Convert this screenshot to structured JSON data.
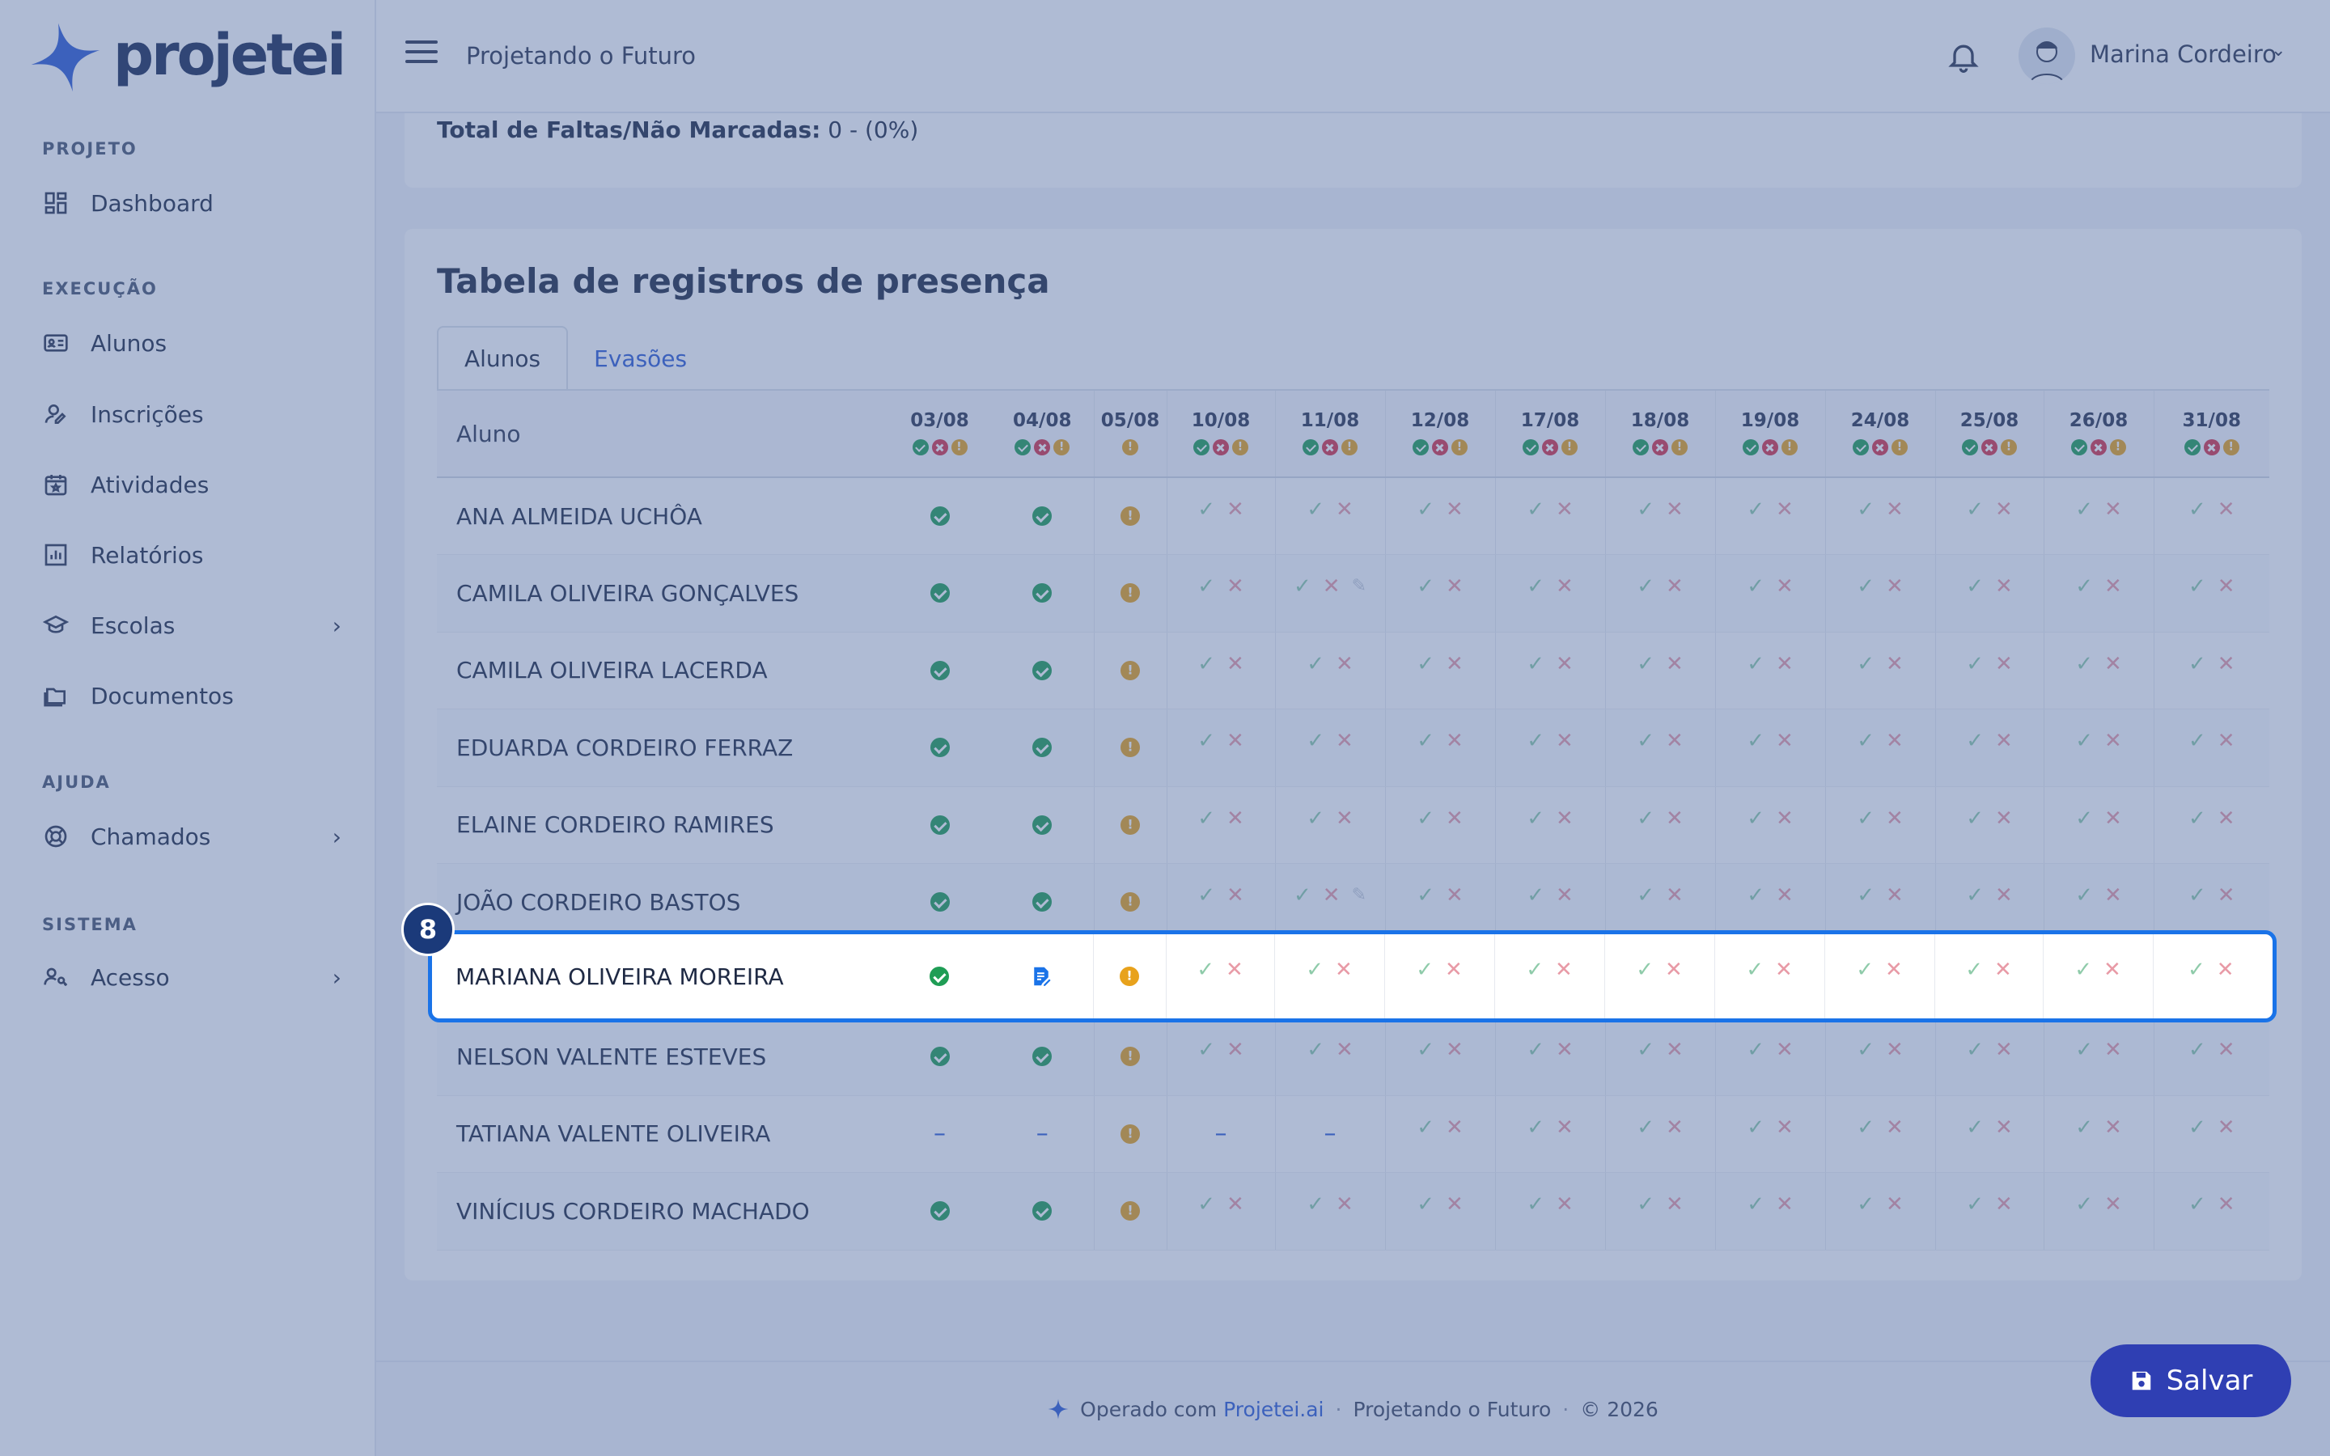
{
  "brand": {
    "logo_text": "projetei"
  },
  "sidebar": {
    "sections": [
      {
        "label": "PROJETO"
      },
      {
        "label": "EXECUÇÃO"
      },
      {
        "label": "AJUDA"
      },
      {
        "label": "SISTEMA"
      }
    ],
    "items": [
      {
        "label": "Dashboard",
        "icon": "dashboard-icon"
      },
      {
        "label": "Alunos",
        "icon": "id-card-icon"
      },
      {
        "label": "Inscrições",
        "icon": "user-edit-icon"
      },
      {
        "label": "Atividades",
        "icon": "calendar-icon"
      },
      {
        "label": "Relatórios",
        "icon": "bar-chart-icon"
      },
      {
        "label": "Escolas",
        "icon": "school-icon"
      },
      {
        "label": "Documentos",
        "icon": "folder-icon"
      },
      {
        "label": "Chamados",
        "icon": "lifebuoy-icon"
      },
      {
        "label": "Acesso",
        "icon": "user-key-icon"
      }
    ]
  },
  "topbar": {
    "title": "Projetando o Futuro",
    "user_name": "Marina Cordeiro"
  },
  "summary": {
    "label": "Total de Faltas/Não Marcadas:",
    "value": "0 - (0%)"
  },
  "attendance": {
    "title": "Tabela de registros de presença",
    "tabs": [
      "Alunos",
      "Evasões"
    ],
    "column_header": "Aluno",
    "dates": [
      "03/08",
      "04/08",
      "05/08",
      "10/08",
      "11/08",
      "12/08",
      "17/08",
      "18/08",
      "19/08",
      "24/08",
      "25/08",
      "26/08",
      "31/08"
    ],
    "rows": [
      {
        "name": "ANA ALMEIDA UCHÔA",
        "cells": [
          "ok",
          "ok",
          "wa",
          "f",
          "f",
          "f",
          "f",
          "f",
          "f",
          "f",
          "f",
          "f",
          "f"
        ]
      },
      {
        "name": "CAMILA OLIVEIRA GONÇALVES",
        "cells": [
          "ok",
          "ok",
          "wa",
          "f",
          "fd",
          "f",
          "f",
          "f",
          "f",
          "f",
          "f",
          "f",
          "f"
        ]
      },
      {
        "name": "CAMILA OLIVEIRA LACERDA",
        "cells": [
          "ok",
          "ok",
          "wa",
          "f",
          "f",
          "f",
          "f",
          "f",
          "f",
          "f",
          "f",
          "f",
          "f"
        ]
      },
      {
        "name": "EDUARDA CORDEIRO FERRAZ",
        "cells": [
          "ok",
          "ok",
          "wa",
          "f",
          "f",
          "f",
          "f",
          "f",
          "f",
          "f",
          "f",
          "f",
          "f"
        ]
      },
      {
        "name": "ELAINE CORDEIRO RAMIRES",
        "cells": [
          "ok",
          "ok",
          "wa",
          "f",
          "f",
          "f",
          "f",
          "f",
          "f",
          "f",
          "f",
          "f",
          "f"
        ]
      },
      {
        "name": "JOÃO CORDEIRO BASTOS",
        "cells": [
          "ok",
          "ok",
          "wa",
          "f",
          "fd",
          "f",
          "f",
          "f",
          "f",
          "f",
          "f",
          "f",
          "f"
        ]
      },
      {
        "name": "MARIANA OLIVEIRA MOREIRA",
        "cells": [
          "ok",
          "note",
          "wa",
          "f",
          "f",
          "f",
          "f",
          "f",
          "f",
          "f",
          "f",
          "f",
          "f"
        ]
      },
      {
        "name": "NELSON VALENTE ESTEVES",
        "cells": [
          "ok",
          "ok",
          "wa",
          "f",
          "f",
          "f",
          "f",
          "f",
          "f",
          "f",
          "f",
          "f",
          "f"
        ]
      },
      {
        "name": "TATIANA VALENTE OLIVEIRA",
        "cells": [
          "dash",
          "dash",
          "wa",
          "dash",
          "dash",
          "f",
          "f",
          "f",
          "f",
          "f",
          "f",
          "f",
          "f"
        ]
      },
      {
        "name": "VINÍCIUS CORDEIRO MACHADO",
        "cells": [
          "ok",
          "ok",
          "wa",
          "f",
          "f",
          "f",
          "f",
          "f",
          "f",
          "f",
          "f",
          "f",
          "f"
        ]
      }
    ],
    "highlight_badge": "8"
  },
  "footer": {
    "operated_by": "Operado com",
    "brand_link": "Projetei.ai",
    "project": "Projetando o Futuro",
    "copyright": "© 2026"
  },
  "save_button": {
    "label": "Salvar"
  },
  "colors": {
    "present": "#1f9d55",
    "absent": "#d6334a",
    "warning": "#e8a21c",
    "accent": "#2f5bd3",
    "highlight_border": "#1a73e8"
  }
}
